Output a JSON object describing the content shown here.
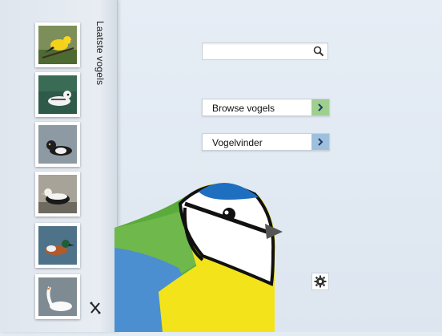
{
  "sidebar": {
    "title": "Laatste vogels",
    "thumbs": [
      {
        "name": "golden-oriole"
      },
      {
        "name": "smew"
      },
      {
        "name": "tufted-duck"
      },
      {
        "name": "eider"
      },
      {
        "name": "shoveler"
      },
      {
        "name": "mute-swan"
      }
    ]
  },
  "search": {
    "value": "",
    "placeholder": ""
  },
  "buttons": {
    "browse": "Browse vogels",
    "finder": "Vogelvinder"
  },
  "colors": {
    "browse_accent": "#9fcf8f",
    "finder_accent": "#9ec0dd",
    "bird_blue_cap": "#1e6fc0",
    "bird_yellow": "#f2e31a",
    "bird_green": "#5aaa3c"
  },
  "icons": [
    "search-icon",
    "chevron-right-icon",
    "gear-icon",
    "tools-icon"
  ]
}
